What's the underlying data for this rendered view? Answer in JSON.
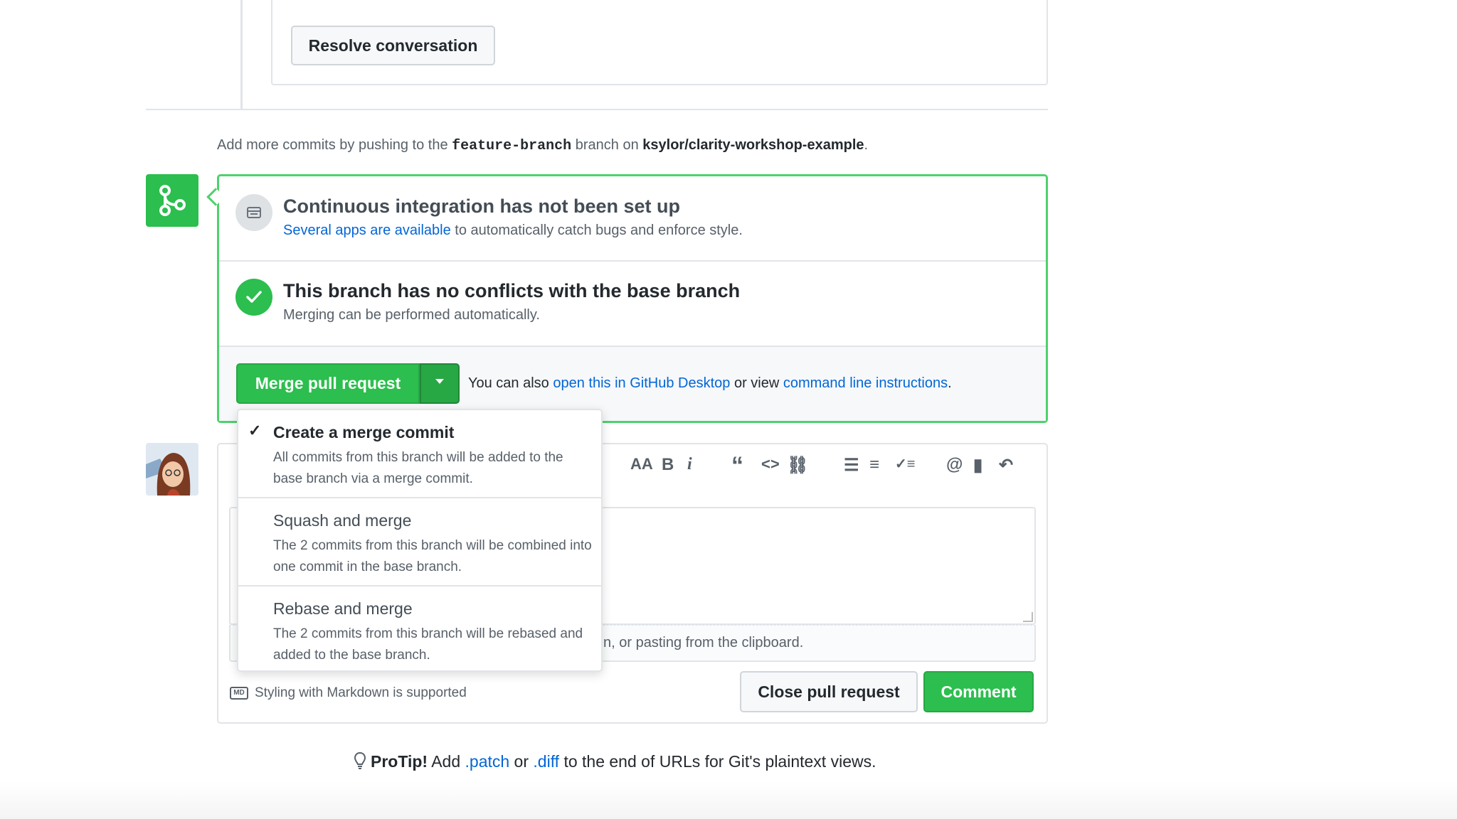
{
  "review": {
    "resolve_label": "Resolve conversation"
  },
  "push_hint": {
    "prefix": "Add more commits by pushing to the ",
    "branch": "feature-branch",
    "middle": " branch on ",
    "repo": "ksylor/clarity-workshop-example",
    "suffix": "."
  },
  "ci": {
    "title": "Continuous integration has not been set up",
    "link": "Several apps are available",
    "rest": " to automatically catch bugs and enforce style."
  },
  "conflicts": {
    "title": "This branch has no conflicts with the base branch",
    "desc": "Merging can be performed automatically."
  },
  "merge": {
    "button_label": "Merge pull request",
    "also_prefix": "You can also ",
    "desktop_link": "open this in GitHub Desktop",
    "or_view": " or view ",
    "cli_link": "command line instructions",
    "also_suffix": "."
  },
  "dropdown": {
    "check": "✓",
    "items": [
      {
        "title": "Create a merge commit",
        "desc": "All commits from this branch will be added to the base branch via a merge commit."
      },
      {
        "title": "Squash and merge",
        "desc": "The 2 commits from this branch will be combined into one commit in the base branch."
      },
      {
        "title": "Rebase and merge",
        "desc": "The 2 commits from this branch will be rebased and added to the base branch."
      }
    ]
  },
  "toolbar": {
    "header": "AA",
    "bold": "B",
    "italic": "i",
    "quote": "“",
    "code": "<>",
    "link": "⛓",
    "ul": "☰",
    "ol": "≡",
    "tasks": "✓≡",
    "mention": "@",
    "saved": "▮",
    "reply": "↶"
  },
  "comment": {
    "attach_tail": "n, or pasting from the clipboard.",
    "md_icon": "MD",
    "markdown": "Styling with Markdown is supported",
    "close_label": "Close pull request",
    "comment_label": "Comment"
  },
  "protip": {
    "bold": "ProTip!",
    "t1": " Add ",
    "patch": ".patch",
    "t2": " or ",
    "diff": ".diff",
    "t3": " to the end of URLs for Git's plaintext views."
  },
  "colors": {
    "green": "#2cbe4e",
    "link": "#0366d6",
    "border_green": "#4fd16d"
  }
}
